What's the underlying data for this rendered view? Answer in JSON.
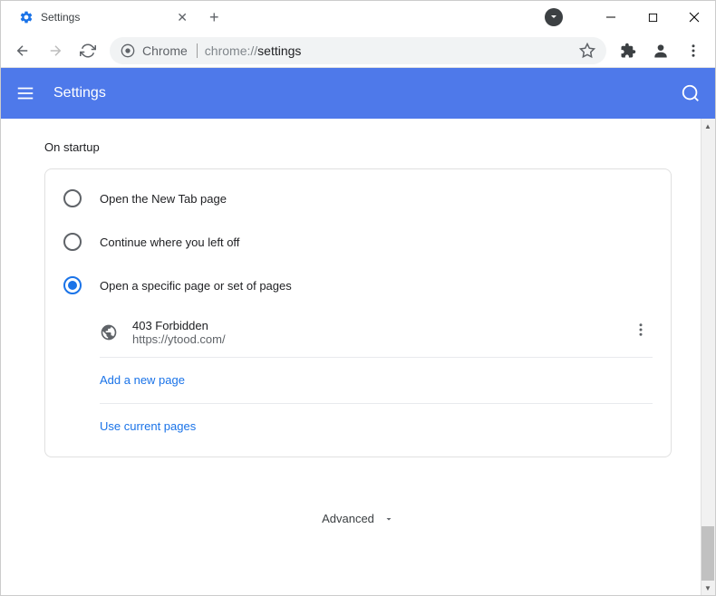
{
  "tab": {
    "title": "Settings"
  },
  "omnibox": {
    "chip": "Chrome",
    "url_prefix": "chrome://",
    "url_path": "settings"
  },
  "appbar": {
    "title": "Settings"
  },
  "section": {
    "title": "On startup"
  },
  "options": {
    "opt1": "Open the New Tab page",
    "opt2": "Continue where you left off",
    "opt3": "Open a specific page or set of pages"
  },
  "page_entry": {
    "name": "403 Forbidden",
    "url": "https://ytood.com/"
  },
  "links": {
    "add": "Add a new page",
    "use_current": "Use current pages"
  },
  "advanced": {
    "label": "Advanced"
  }
}
